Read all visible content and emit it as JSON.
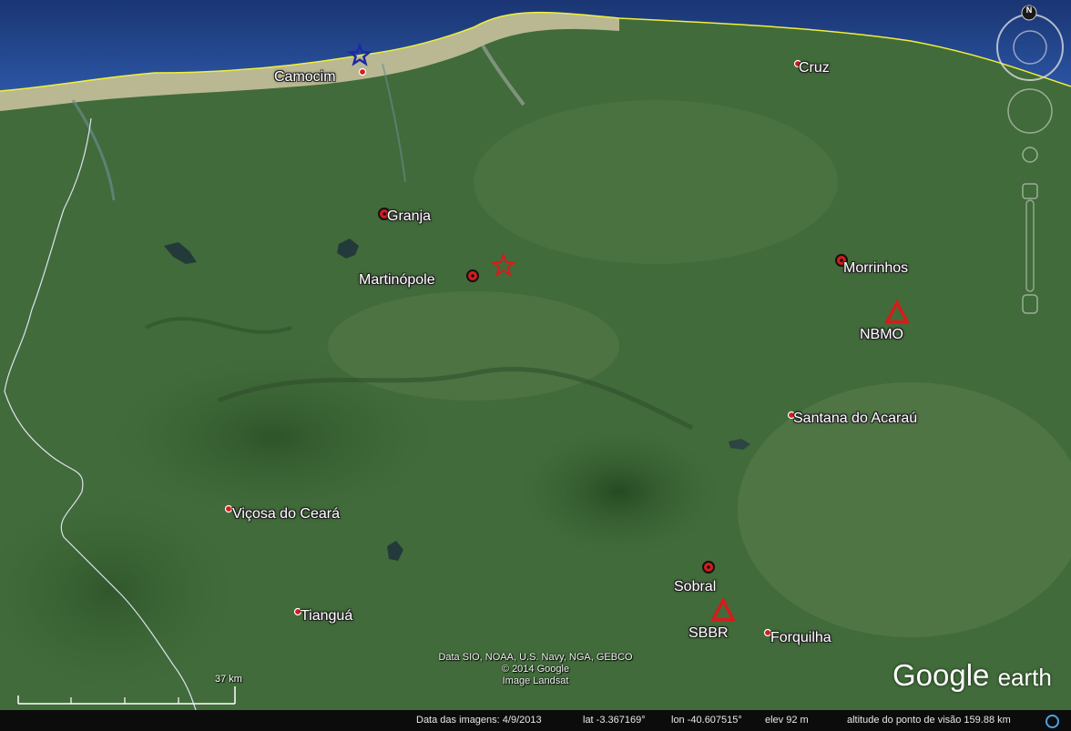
{
  "map": {
    "places": [
      {
        "name": "Camocim",
        "marker": "town-dot"
      },
      {
        "name": "Cruz",
        "marker": "town-dot"
      },
      {
        "name": "Granja",
        "marker": "city-circle"
      },
      {
        "name": "Martinópole",
        "marker": "city-circle"
      },
      {
        "name": "Morrinhos",
        "marker": "city-circle"
      },
      {
        "name": "Santana do Acaraú",
        "marker": "town-dot"
      },
      {
        "name": "Viçosa do Ceará",
        "marker": "town-dot"
      },
      {
        "name": "Tianguá",
        "marker": "town-dot"
      },
      {
        "name": "Sobral",
        "marker": "city-circle"
      },
      {
        "name": "Forquilha",
        "marker": "town-dot"
      }
    ],
    "stations": [
      "NBMO",
      "SBBR"
    ],
    "copyright": [
      "Data SIO, NOAA, U.S. Navy, NGA, GEBCO",
      "© 2014 Google",
      "Image Landsat"
    ],
    "scale_label": "37 km",
    "logo": {
      "brand": "Google",
      "product": "earth"
    },
    "compass_letter": "N"
  },
  "status_bar": {
    "imagery_date": "Data das imagens: 4/9/2013",
    "lat": "lat   -3.367169°",
    "lon": "lon  -40.607515°",
    "elev": "elev     92 m",
    "eye_alt": "altitude do ponto de visão 159.88 km"
  },
  "colors": {
    "ocean": "#1f3f86",
    "coast_sand": "#d8d0ae",
    "land": "#3f6a3a",
    "coastline": "#f2ef3a",
    "boundary": "#dde3ee",
    "marker_red": "#d51c1c",
    "star_blue": "#1b2aa8"
  }
}
